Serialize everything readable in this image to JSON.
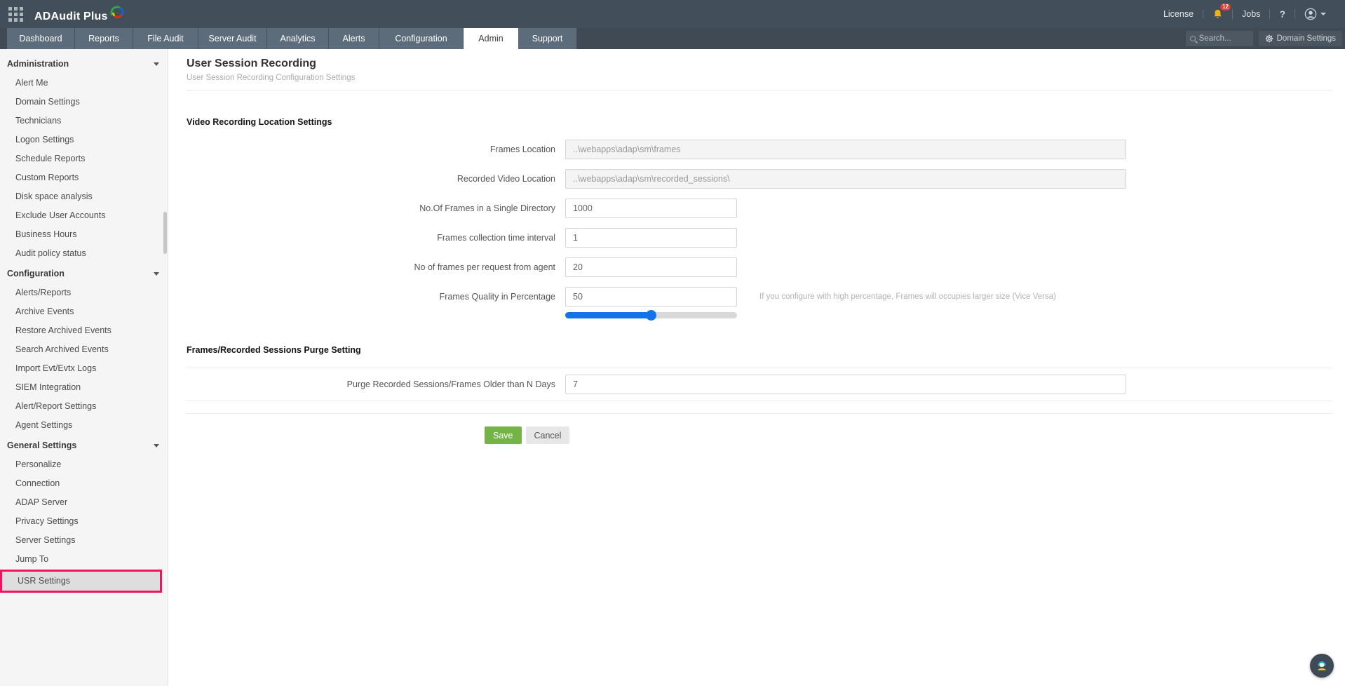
{
  "header": {
    "logo_text": "ADAudit Plus",
    "license_label": "License",
    "notification_count": "12",
    "jobs_label": "Jobs",
    "help_label": "?"
  },
  "tabs": [
    {
      "label": "Dashboard",
      "active": false
    },
    {
      "label": "Reports",
      "active": false
    },
    {
      "label": "File Audit",
      "active": false
    },
    {
      "label": "Server Audit",
      "active": false
    },
    {
      "label": "Analytics",
      "active": false
    },
    {
      "label": "Alerts",
      "active": false
    },
    {
      "label": "Configuration",
      "active": false
    },
    {
      "label": "Admin",
      "active": true
    },
    {
      "label": "Support",
      "active": false
    }
  ],
  "toolbar": {
    "search_placeholder": "Search...",
    "domain_settings_label": "Domain Settings"
  },
  "sidebar": {
    "sections": [
      {
        "title": "Administration",
        "items": [
          "Alert Me",
          "Domain Settings",
          "Technicians",
          "Logon Settings",
          "Schedule Reports",
          "Custom Reports",
          "Disk space analysis",
          "Exclude User Accounts",
          "Business Hours",
          "Audit policy status"
        ]
      },
      {
        "title": "Configuration",
        "items": [
          "Alerts/Reports",
          "Archive Events",
          "Restore Archived Events",
          "Search Archived Events",
          "Import Evt/Evtx Logs",
          "SIEM Integration",
          "Alert/Report Settings",
          "Agent Settings"
        ]
      },
      {
        "title": "General Settings",
        "items": [
          "Personalize",
          "Connection",
          "ADAP Server",
          "Privacy Settings",
          "Server Settings",
          "Jump To",
          "USR Settings"
        ]
      }
    ],
    "selected_item": "USR Settings"
  },
  "main": {
    "title": "User Session Recording",
    "subtitle": "User Session Recording Configuration Settings",
    "section_video": "Video Recording Location Settings",
    "fields": [
      {
        "label": "Frames Location",
        "value": "..\\webapps\\adap\\sm\\frames",
        "disabled": true
      },
      {
        "label": "Recorded Video Location",
        "value": "..\\webapps\\adap\\sm\\recorded_sessions\\",
        "disabled": true
      },
      {
        "label": "No.Of Frames in a Single Directory",
        "value": "1000",
        "disabled": false
      },
      {
        "label": "Frames collection time interval",
        "value": "1",
        "disabled": false
      },
      {
        "label": "No of frames per request from agent",
        "value": "20",
        "disabled": false
      },
      {
        "label": "Frames Quality in Percentage",
        "value": "50",
        "disabled": false
      }
    ],
    "quality_slider": {
      "value": 50,
      "color": "#1273eb"
    },
    "quality_hint": "If you configure with high percentage, Frames will occupies larger size (Vice Versa)",
    "section_purge": "Frames/Recorded Sessions Purge Setting",
    "purge_field": {
      "label": "Purge Recorded Sessions/Frames Older than N Days",
      "value": "7"
    },
    "save_label": "Save",
    "cancel_label": "Cancel"
  },
  "colors": {
    "header_bg": "#424e5a",
    "tabbar_bg": "#3f4a54",
    "tab_bg": "#5d6c7b",
    "highlight_pink": "#f0145f",
    "slider_blue": "#1273eb",
    "save_green": "#74b446",
    "bell_yellow": "#f0b40f",
    "badge_red": "#e03c31"
  }
}
